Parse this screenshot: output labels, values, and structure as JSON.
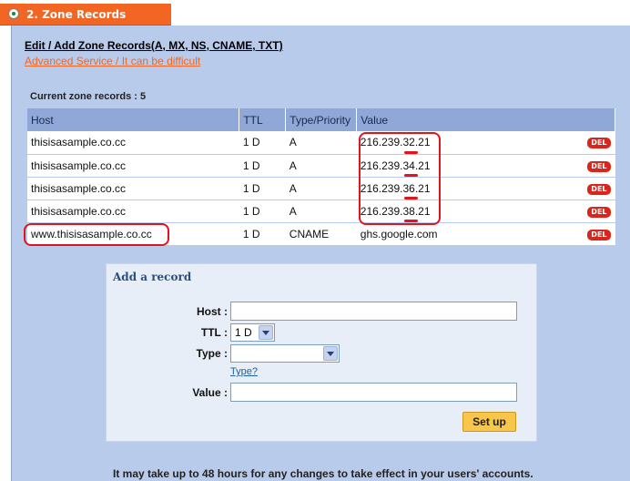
{
  "tab": {
    "title": "2. Zone Records"
  },
  "header": {
    "edit_title": "Edit / Add Zone Records(A, MX, NS, CNAME, TXT)",
    "advanced_link": "Advanced Service / It can be difficult"
  },
  "records": {
    "count_label": "Current zone records : 5",
    "columns": [
      "Host",
      "TTL",
      "Type/Priority",
      "Value"
    ],
    "del_label": "DEL",
    "rows": [
      {
        "host": "thisisasample.co.cc",
        "ttl": "1 D",
        "type": "A",
        "value": "216.239.32.21"
      },
      {
        "host": "thisisasample.co.cc",
        "ttl": "1 D",
        "type": "A",
        "value": "216.239.34.21"
      },
      {
        "host": "thisisasample.co.cc",
        "ttl": "1 D",
        "type": "A",
        "value": "216.239.36.21"
      },
      {
        "host": "thisisasample.co.cc",
        "ttl": "1 D",
        "type": "A",
        "value": "216.239.38.21"
      },
      {
        "host": "www.thisisasample.co.cc",
        "ttl": "1 D",
        "type": "CNAME",
        "value": "ghs.google.com"
      }
    ]
  },
  "add_record": {
    "title": "Add a record",
    "host_label": "Host :",
    "host_value": "",
    "ttl_label": "TTL :",
    "ttl_selected": "1 D",
    "type_label": "Type :",
    "type_selected": "",
    "type_help": "Type?",
    "value_label": "Value :",
    "value_value": "",
    "setup_button": "Set up"
  },
  "footer": {
    "note": "It may take up to 48 hours for any changes to take effect in your users' accounts."
  },
  "colors": {
    "tab": "#f26522",
    "panel": "#b9cbea",
    "annotation": "#e0141c",
    "del": "#d9251c",
    "setup": "#f7c64a"
  }
}
